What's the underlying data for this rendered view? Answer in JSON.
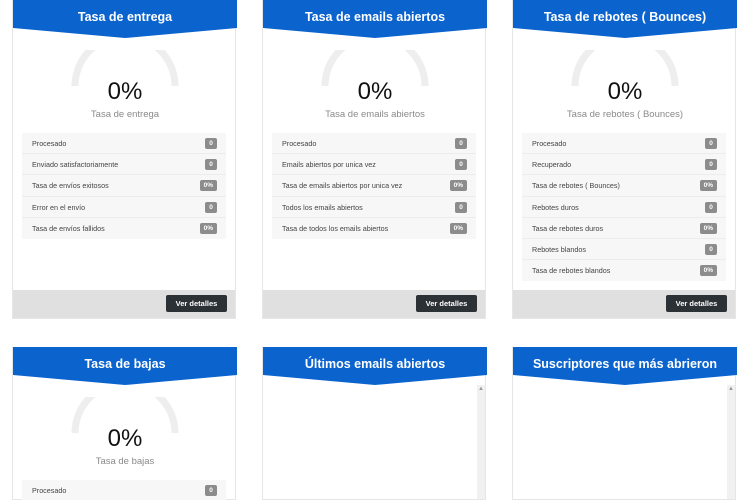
{
  "colors": {
    "header": "#0b63ce",
    "gauge_track": "#eeeeee",
    "badge": "#8c8c8c",
    "button": "#2c3136",
    "footer": "#e0e0e0"
  },
  "cards": {
    "delivery": {
      "title": "Tasa de entrega",
      "gauge_value": "0%",
      "gauge_label": "Tasa de entrega",
      "rows": [
        {
          "label": "Procesado",
          "value": "0"
        },
        {
          "label": "Enviado satisfactoriamente",
          "value": "0"
        },
        {
          "label": "Tasa de envíos exitosos",
          "value": "0%"
        },
        {
          "label": "Error en el envío",
          "value": "0"
        },
        {
          "label": "Tasa de envíos fallidos",
          "value": "0%"
        }
      ],
      "button": "Ver detalles"
    },
    "opens": {
      "title": "Tasa de emails abiertos",
      "gauge_value": "0%",
      "gauge_label": "Tasa de emails abiertos",
      "rows": [
        {
          "label": "Procesado",
          "value": "0"
        },
        {
          "label": "Emails abiertos por unica vez",
          "value": "0"
        },
        {
          "label": "Tasa de emails abiertos por unica vez",
          "value": "0%"
        },
        {
          "label": "Todos los emails abiertos",
          "value": "0"
        },
        {
          "label": "Tasa de todos los emails abiertos",
          "value": "0%"
        }
      ],
      "button": "Ver detalles"
    },
    "bounces": {
      "title": "Tasa de rebotes ( Bounces)",
      "gauge_value": "0%",
      "gauge_label": "Tasa de rebotes ( Bounces)",
      "rows": [
        {
          "label": "Procesado",
          "value": "0"
        },
        {
          "label": "Recuperado",
          "value": "0"
        },
        {
          "label": "Tasa de rebotes ( Bounces)",
          "value": "0%"
        },
        {
          "label": "Rebotes duros",
          "value": "0"
        },
        {
          "label": "Tasa de rebotes duros",
          "value": "0%"
        },
        {
          "label": "Rebotes blandos",
          "value": "0"
        },
        {
          "label": "Tasa de rebotes blandos",
          "value": "0%"
        }
      ],
      "button": "Ver detalles"
    },
    "unsubs": {
      "title": "Tasa de bajas",
      "gauge_value": "0%",
      "gauge_label": "Tasa de bajas",
      "rows": [
        {
          "label": "Procesado",
          "value": "0"
        }
      ]
    },
    "last_opened": {
      "title": "Últimos emails abiertos"
    },
    "top_subscribers": {
      "title": "Suscriptores que más abrieron"
    }
  }
}
